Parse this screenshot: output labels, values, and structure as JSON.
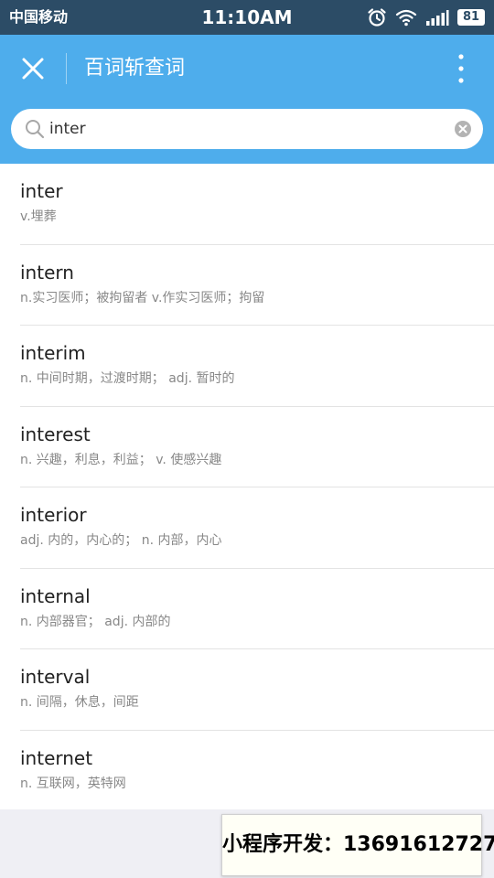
{
  "status_bar": {
    "carrier": "中国移动",
    "time": "11:10AM",
    "battery": "81",
    "icons": [
      "alarm-icon",
      "wifi-icon",
      "signal-icon",
      "battery-icon"
    ]
  },
  "nav": {
    "title": "百词斩查词",
    "close_icon": "close-icon",
    "more_icon": "more-vertical-icon"
  },
  "search": {
    "value": "inter"
  },
  "results": [
    {
      "word": "inter",
      "meaning": "v.埋葬"
    },
    {
      "word": "intern",
      "meaning": "n.实习医师；被拘留者 v.作实习医师；拘留"
    },
    {
      "word": "interim",
      "meaning": "n. 中间时期，过渡时期； adj. 暂时的"
    },
    {
      "word": "interest",
      "meaning": "n. 兴趣，利息，利益； v. 使感兴趣"
    },
    {
      "word": "interior",
      "meaning": "adj. 内的，内心的； n. 内部，内心"
    },
    {
      "word": "internal",
      "meaning": "n. 内部器官； adj. 内部的"
    },
    {
      "word": "interval",
      "meaning": "n. 间隔，休息，间距"
    },
    {
      "word": "internet",
      "meaning": "n. 互联网，英特网"
    }
  ],
  "contact": "小程序开发：13691612727",
  "colors": {
    "status_bar": "#2c4c66",
    "accent": "#4eadec",
    "background": "#efeff4"
  }
}
